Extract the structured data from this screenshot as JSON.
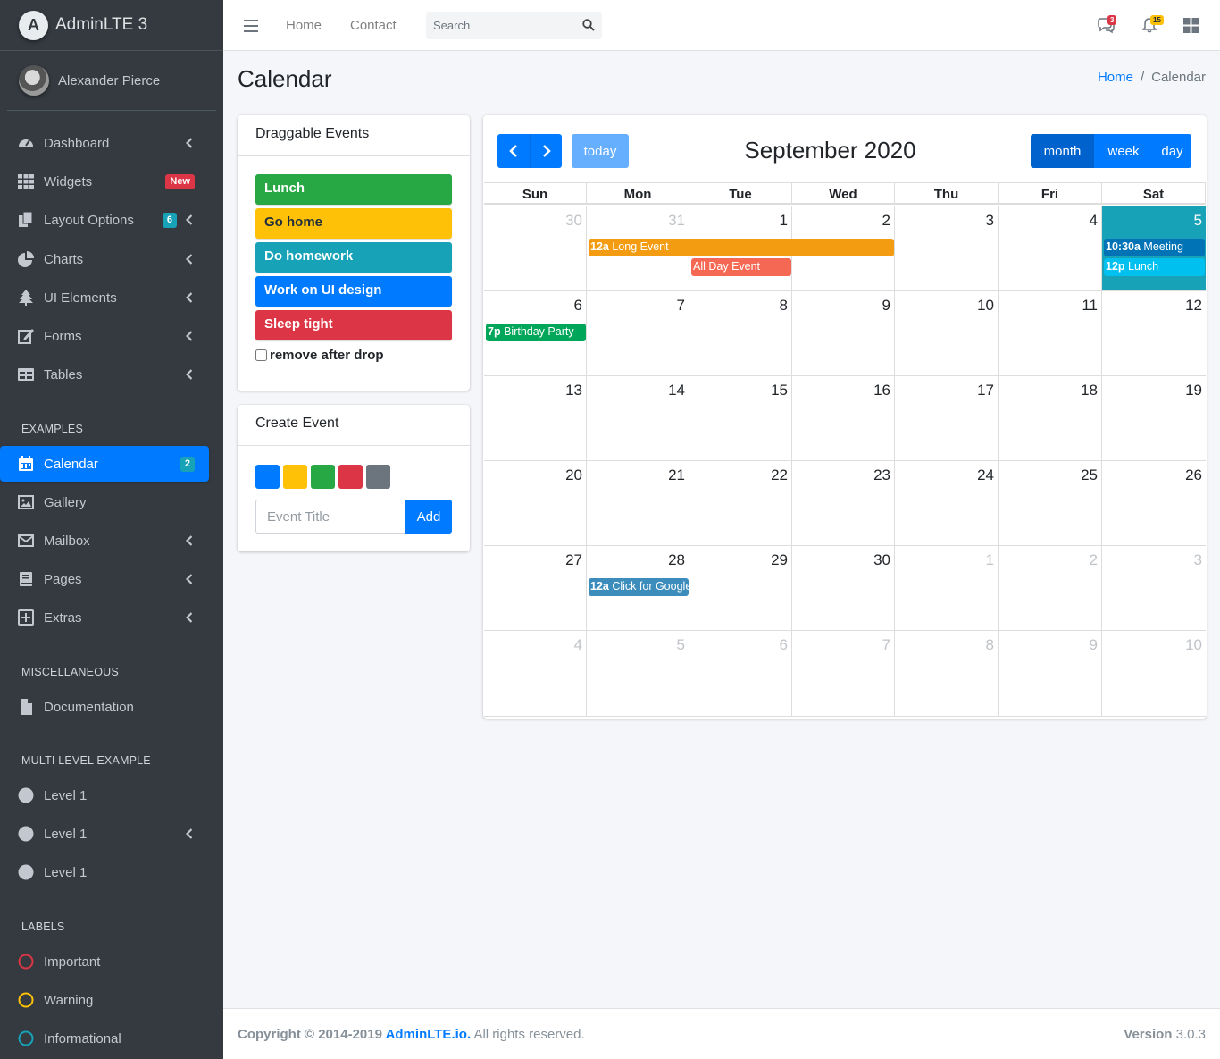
{
  "brand": {
    "logo_letter": "A",
    "name": "AdminLTE 3"
  },
  "user": {
    "name": "Alexander Pierce"
  },
  "sidebar": {
    "items": [
      {
        "label": "Dashboard",
        "icon": "tachometer-icon"
      },
      {
        "label": "Widgets",
        "icon": "th-icon",
        "badge": "New",
        "badge_color": "#dc3545"
      },
      {
        "label": "Layout Options",
        "icon": "copy-icon",
        "badge": "6",
        "badge_color": "#17a2b8"
      },
      {
        "label": "Charts",
        "icon": "pie-chart-icon"
      },
      {
        "label": "UI Elements",
        "icon": "tree-icon"
      },
      {
        "label": "Forms",
        "icon": "edit-icon"
      },
      {
        "label": "Tables",
        "icon": "table-icon"
      }
    ],
    "examples_header": "EXAMPLES",
    "examples": [
      {
        "label": "Calendar",
        "icon": "calendar-icon",
        "badge": "2",
        "badge_color": "#17a2b8",
        "active": true
      },
      {
        "label": "Gallery",
        "icon": "image-icon"
      },
      {
        "label": "Mailbox",
        "icon": "envelope-icon"
      },
      {
        "label": "Pages",
        "icon": "book-icon"
      },
      {
        "label": "Extras",
        "icon": "plus-square-icon"
      }
    ],
    "misc_header": "MISCELLANEOUS",
    "misc": [
      {
        "label": "Documentation",
        "icon": "file-icon"
      }
    ],
    "multi_header": "MULTI LEVEL EXAMPLE",
    "multi": [
      {
        "label": "Level 1"
      },
      {
        "label": "Level 1"
      },
      {
        "label": "Level 1"
      }
    ],
    "labels_header": "LABELS",
    "labels": [
      {
        "label": "Important",
        "color": "#dc3545"
      },
      {
        "label": "Warning",
        "color": "#ffc107"
      },
      {
        "label": "Informational",
        "color": "#17a2b8"
      }
    ]
  },
  "topbar": {
    "home": "Home",
    "contact": "Contact",
    "search_placeholder": "Search",
    "messages_count": "3",
    "notifications_count": "15"
  },
  "page": {
    "title": "Calendar",
    "breadcrumb_home": "Home",
    "breadcrumb_current": "Calendar"
  },
  "draggable": {
    "title": "Draggable Events",
    "events": [
      {
        "label": "Lunch",
        "color": "#28a745"
      },
      {
        "label": "Go home",
        "color": "#ffc107"
      },
      {
        "label": "Do homework",
        "color": "#17a2b8"
      },
      {
        "label": "Work on UI design",
        "color": "#007bff"
      },
      {
        "label": "Sleep tight",
        "color": "#dc3545"
      }
    ],
    "remove_label": "remove after drop"
  },
  "create_event": {
    "title": "Create Event",
    "colors": [
      "#007bff",
      "#ffc107",
      "#28a745",
      "#dc3545",
      "#6c757d"
    ],
    "placeholder": "Event Title",
    "add_label": "Add"
  },
  "calendar": {
    "title": "September 2020",
    "today_label": "today",
    "views": [
      "month",
      "week",
      "day"
    ],
    "weekdays": [
      "Sun",
      "Mon",
      "Tue",
      "Wed",
      "Thu",
      "Fri",
      "Sat"
    ],
    "weeks": [
      [
        {
          "d": "30",
          "o": true
        },
        {
          "d": "31",
          "o": true
        },
        {
          "d": "1"
        },
        {
          "d": "2"
        },
        {
          "d": "3"
        },
        {
          "d": "4"
        },
        {
          "d": "5",
          "today": true
        }
      ],
      [
        {
          "d": "6"
        },
        {
          "d": "7"
        },
        {
          "d": "8"
        },
        {
          "d": "9"
        },
        {
          "d": "10"
        },
        {
          "d": "11"
        },
        {
          "d": "12"
        }
      ],
      [
        {
          "d": "13"
        },
        {
          "d": "14"
        },
        {
          "d": "15"
        },
        {
          "d": "16"
        },
        {
          "d": "17"
        },
        {
          "d": "18"
        },
        {
          "d": "19"
        }
      ],
      [
        {
          "d": "20"
        },
        {
          "d": "21"
        },
        {
          "d": "22"
        },
        {
          "d": "23"
        },
        {
          "d": "24"
        },
        {
          "d": "25"
        },
        {
          "d": "26"
        }
      ],
      [
        {
          "d": "27"
        },
        {
          "d": "28"
        },
        {
          "d": "29"
        },
        {
          "d": "30"
        },
        {
          "d": "1",
          "o": true
        },
        {
          "d": "2",
          "o": true
        },
        {
          "d": "3",
          "o": true
        }
      ],
      [
        {
          "d": "4",
          "o": true
        },
        {
          "d": "5",
          "o": true
        },
        {
          "d": "6",
          "o": true
        },
        {
          "d": "7",
          "o": true
        },
        {
          "d": "8",
          "o": true
        },
        {
          "d": "9",
          "o": true
        },
        {
          "d": "10",
          "o": true
        }
      ]
    ],
    "events": [
      {
        "time": "12a",
        "title": "Long Event",
        "week": 0,
        "start": 1,
        "span": 3,
        "slot": 0,
        "color": "#f39c12"
      },
      {
        "time": "",
        "title": "All Day Event",
        "week": 0,
        "start": 2,
        "span": 1,
        "slot": 1,
        "color": "#f56954"
      },
      {
        "time": "10:30a",
        "title": "Meeting",
        "week": 0,
        "start": 6,
        "span": 1,
        "slot": 0,
        "color": "#0073b7"
      },
      {
        "time": "12p",
        "title": "Lunch",
        "week": 0,
        "start": 6,
        "span": 1,
        "slot": 1,
        "color": "#00c0ef"
      },
      {
        "time": "7p",
        "title": "Birthday Party",
        "week": 1,
        "start": 0,
        "span": 1,
        "slot": 0,
        "color": "#00a65a"
      },
      {
        "time": "12a",
        "title": "Click for Google",
        "week": 4,
        "start": 1,
        "span": 1,
        "slot": 0,
        "color": "#3c8dbc"
      }
    ]
  },
  "footer": {
    "copyright": "Copyright © 2014-2019 ",
    "link": "AdminLTE.io.",
    "rights": " All rights reserved.",
    "version_label": "Version",
    "version": " 3.0.3"
  }
}
